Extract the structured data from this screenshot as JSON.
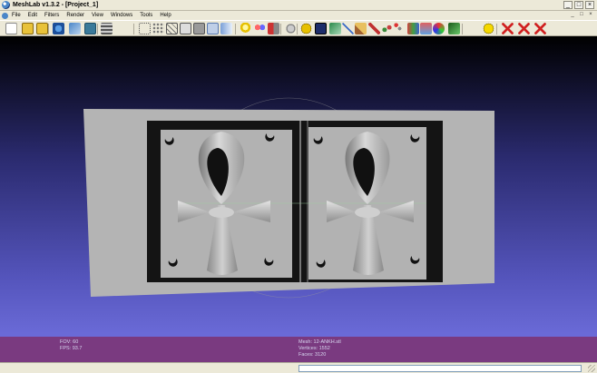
{
  "window": {
    "title": "MeshLab v1.3.2 - [Project_1]",
    "controls": [
      "_",
      "□",
      "×"
    ]
  },
  "menubar": {
    "items": [
      "File",
      "Edit",
      "Filters",
      "Render",
      "View",
      "Windows",
      "Tools",
      "Help"
    ],
    "mdi_controls": [
      "_",
      "□",
      "×"
    ]
  },
  "toolbar": {
    "icons": [
      "new-project-icon",
      "open-project-icon",
      "import-mesh-icon",
      "reload-icon",
      "export-mesh-icon",
      "snapshot-icon",
      "layers-icon",
      "bbox-icon",
      "points-icon",
      "wireframe-icon",
      "hidden-lines-icon",
      "flat-lines-icon",
      "flat-icon",
      "smooth-icon",
      "light-icon",
      "double-light-icon",
      "fancy-light-icon",
      "back-face-icon",
      "annotation-icon",
      "mesh-info-icon",
      "texture-icon",
      "measure-icon",
      "paint-icon",
      "selection-icon",
      "align-icon",
      "pick-points-icon",
      "manipulator-icon",
      "quality-icon",
      "vertex-color-icon",
      "shader-icon",
      "info-icon",
      "delete-selection-icon",
      "delete-faces-icon",
      "delete-vertices-icon"
    ]
  },
  "viewport": {
    "mesh_name": "12-ANKH.stl"
  },
  "info": {
    "fov": "FOV: 60",
    "fps": "FPS:   93.7",
    "mesh": "Mesh: 12-ANKH.stl",
    "vertices": "Vertices: 1552",
    "faces": "Faces: 3120"
  },
  "colors": {
    "info_bg": "#7a3a80",
    "chrome_bg": "#ece9d8",
    "mesh_gray": "#b0b0b0"
  }
}
